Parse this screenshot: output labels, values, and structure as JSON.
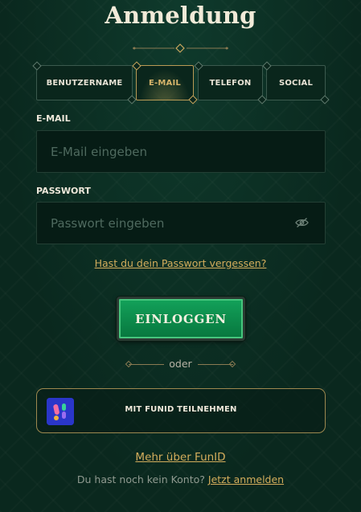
{
  "header": {
    "title": "Anmeldung"
  },
  "tabs": [
    {
      "label": "BENUTZERNAME",
      "active": false
    },
    {
      "label": "E-MAIL",
      "active": true
    },
    {
      "label": "TELEFON",
      "active": false
    },
    {
      "label": "SOCIAL",
      "active": false
    }
  ],
  "form": {
    "email_label": "E-MAIL",
    "email_value": "",
    "email_placeholder": "E-Mail eingeben",
    "password_label": "PASSWORT",
    "password_value": "",
    "password_placeholder": "Passwort eingeben",
    "forgot_link": "Hast du dein Passwort vergessen?"
  },
  "actions": {
    "login_label": "EINLOGGEN",
    "or_text": "oder",
    "funid_label": "MIT FUNID TEILNEHMEN",
    "more_funid_link": "Mehr über FunID"
  },
  "footer": {
    "no_account_text": "Du hast noch kein Konto?",
    "register_link": "Jetzt anmelden"
  },
  "colors": {
    "background": "#0b2c21",
    "accent_gold": "#d4ad5c",
    "button_green": "#0d8c4c",
    "funid_blue": "#2a36c9"
  },
  "icons": {
    "password_toggle": "eye-slash-icon",
    "funid_logo": "funid-logo-icon"
  }
}
